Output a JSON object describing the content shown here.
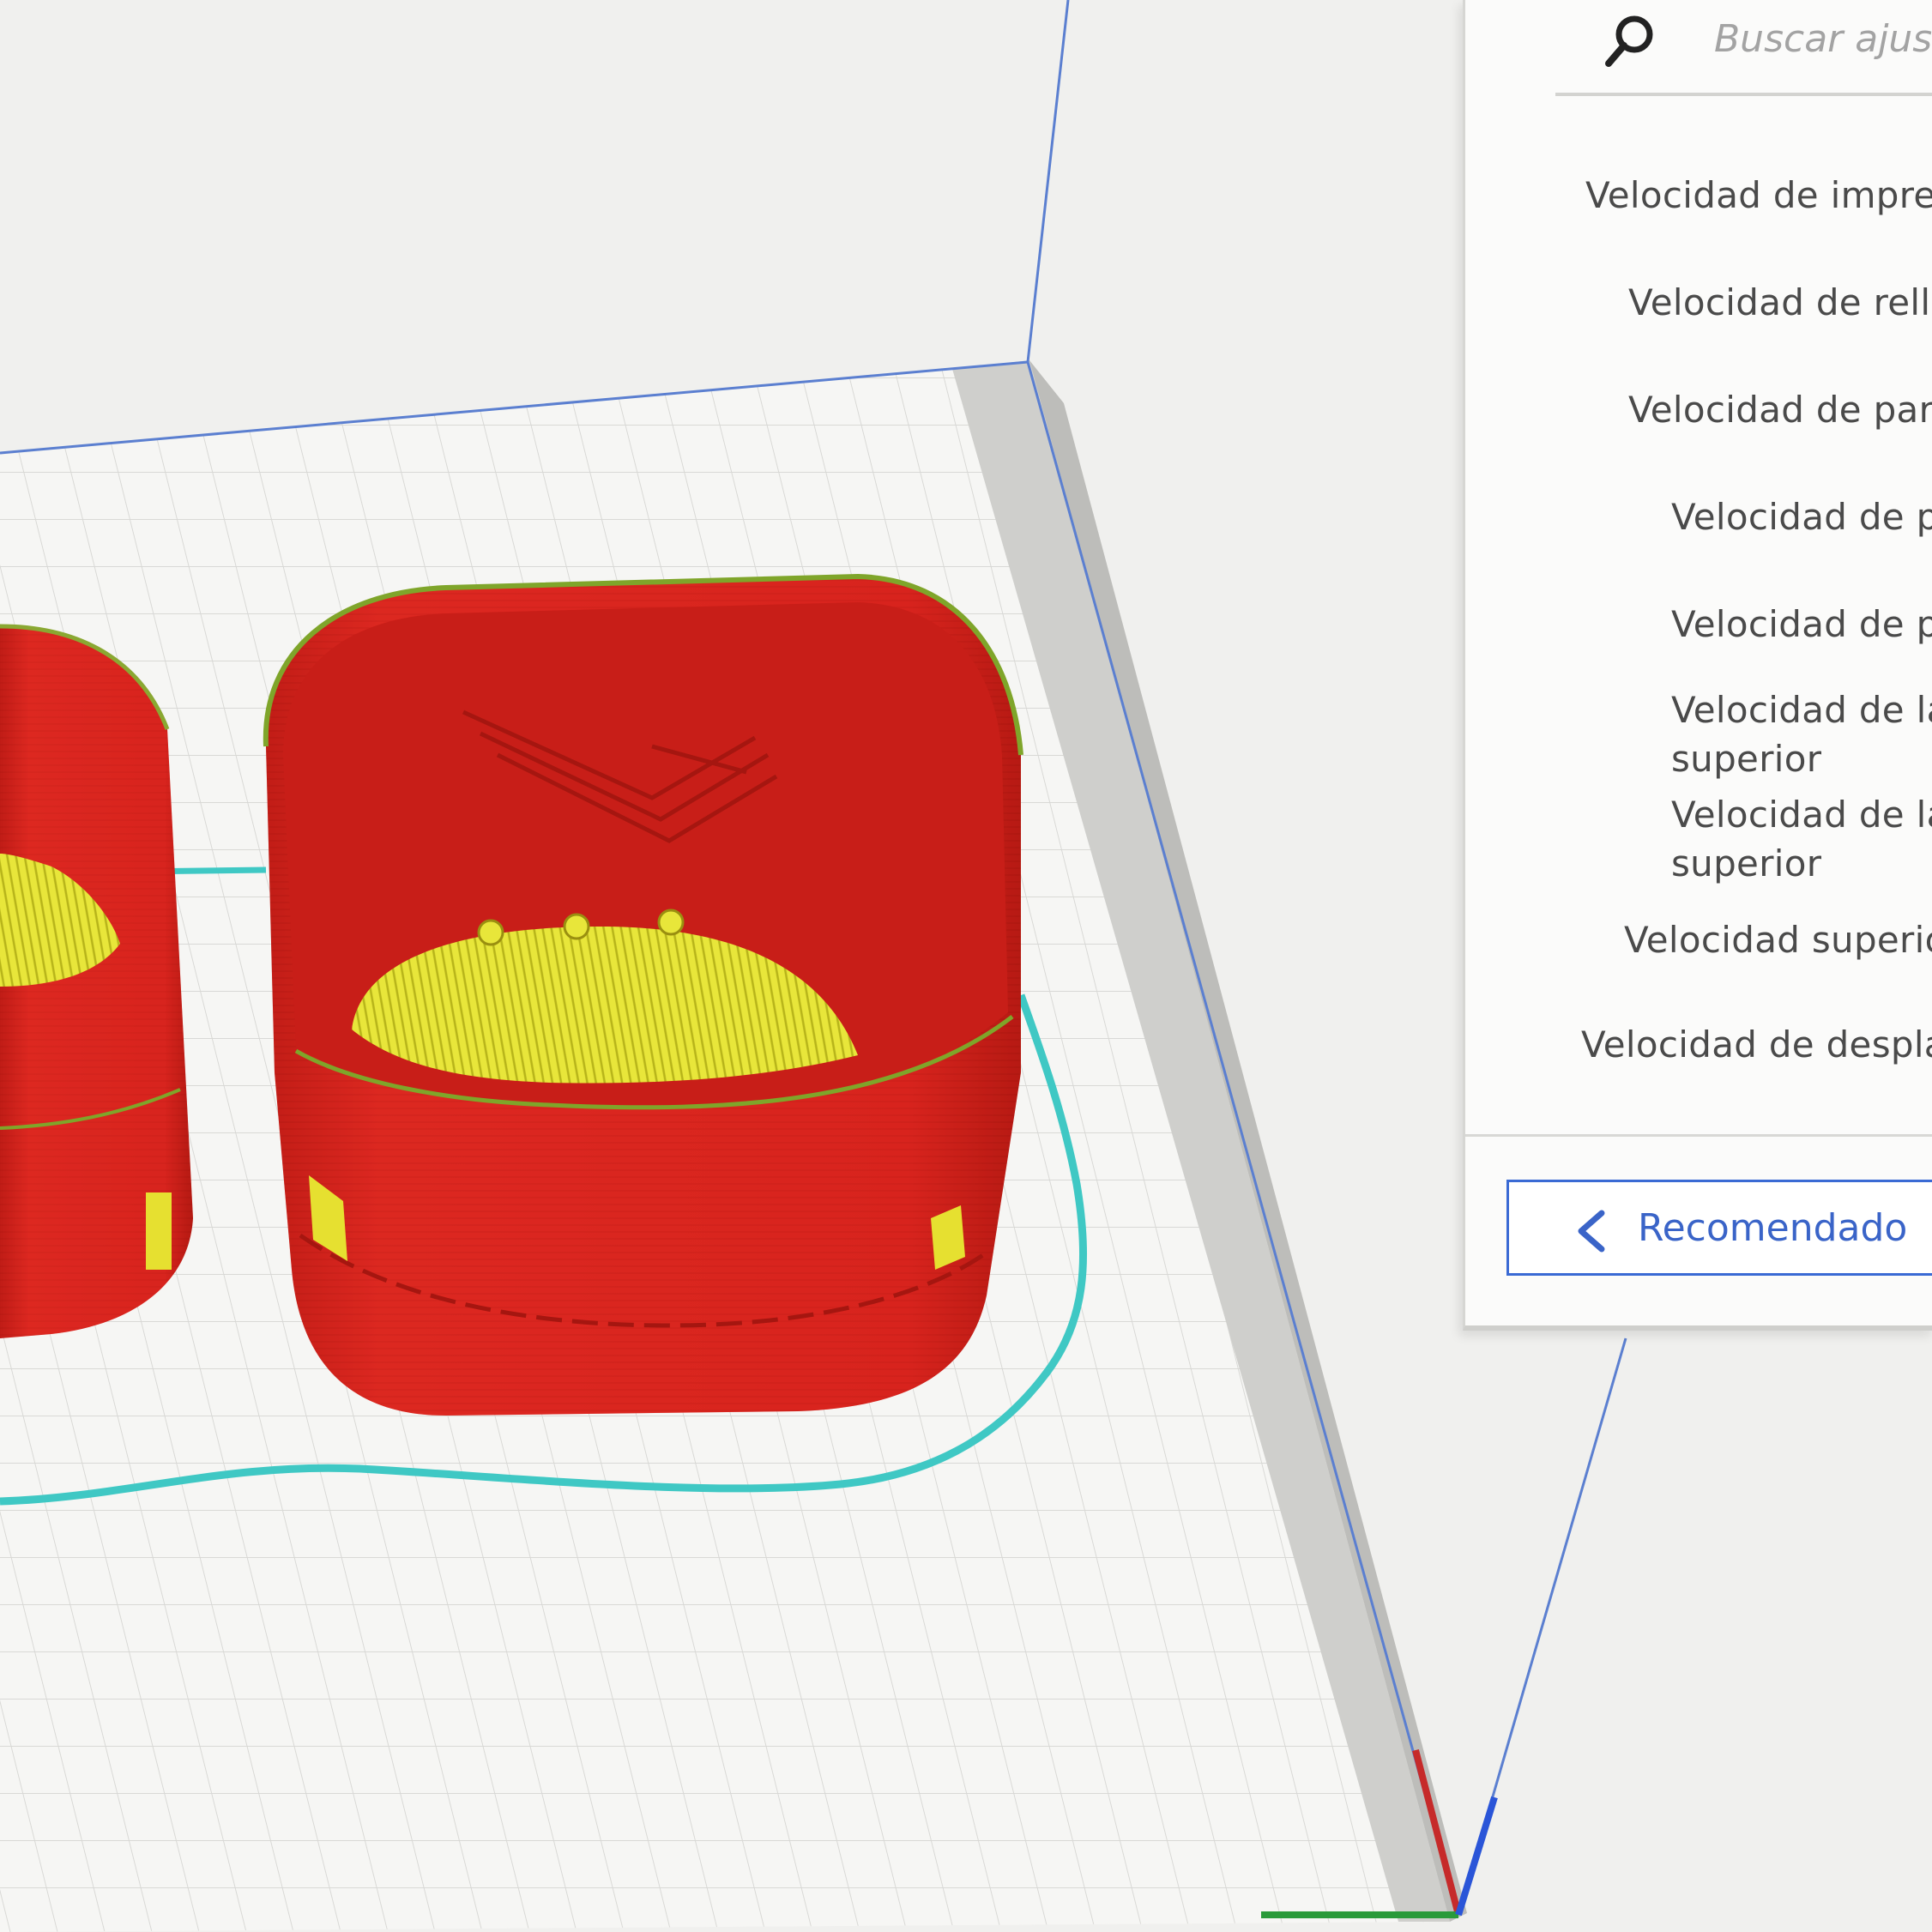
{
  "search": {
    "placeholder": "Buscar ajuste"
  },
  "settings": {
    "items": [
      {
        "id": "print-speed",
        "label": "Velocidad de impres"
      },
      {
        "id": "infill-speed",
        "label": "Velocidad de relle"
      },
      {
        "id": "wall-speed",
        "label": "Velocidad de pare"
      },
      {
        "id": "outer-wall-speed",
        "label": "Velocidad de p"
      },
      {
        "id": "inner-wall-speed",
        "label": "Velocidad de p"
      },
      {
        "id": "top-surface-skin-wall-speed",
        "label": "Velocidad de la",
        "sublabel": "superior"
      },
      {
        "id": "top-surface-skin-speed",
        "label": "Velocidad de la",
        "sublabel": "superior"
      },
      {
        "id": "top-bottom-speed",
        "label": "Velocidad superio"
      },
      {
        "id": "travel-speed",
        "label": "Velocidad de desplaz"
      }
    ]
  },
  "footer": {
    "recommended_label": "Recomendado",
    "recommended_icon": "chevron-left-icon"
  },
  "colors": {
    "model_wall": "#d8221c",
    "model_infill": "#e4e22a",
    "skirt": "#3fc8c4",
    "build_volume_edge": "#5b7fd0",
    "axis_x": "#c62a2a",
    "axis_y": "#2a9a3a",
    "axis_z": "#2a55d8",
    "accent": "#3a6ad4"
  }
}
